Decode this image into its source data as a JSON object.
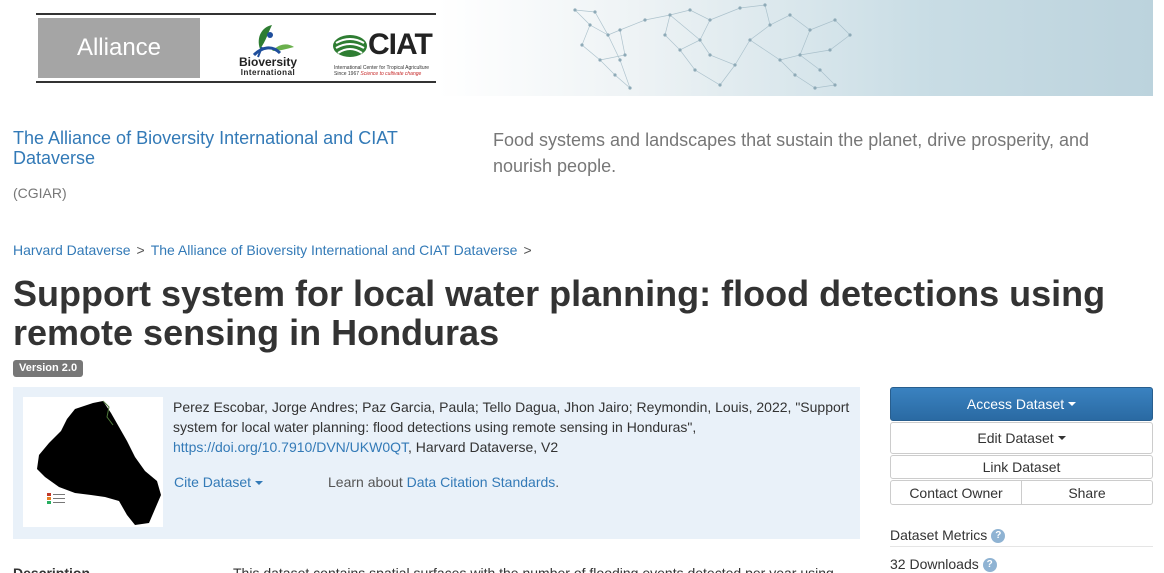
{
  "banner": {
    "alliance_label": "Alliance",
    "bioversity_name": "Bioversity",
    "bioversity_sub": "International",
    "ciat_name": "CIAT",
    "ciat_sub1": "International Center for Tropical Agriculture",
    "ciat_sub2_prefix": "Since 1967",
    "ciat_sub2_slogan": "Science to cultivate change",
    "colors": {
      "ciat_green": "#2e7d32",
      "bioversity_blue": "#1f4e9c",
      "slogan_red": "#c62828"
    }
  },
  "dataverse": {
    "title": "The Alliance of Bioversity International and CIAT Dataverse",
    "affiliation": "(CGIAR)",
    "tagline": "Food systems and landscapes that sustain the planet, drive prosperity, and nourish people."
  },
  "breadcrumb": {
    "items": [
      "Harvard Dataverse",
      "The Alliance of Bioversity International and CIAT Dataverse"
    ],
    "separator": ">"
  },
  "dataset": {
    "title": "Support system for local water planning: flood detections using remote sensing in Honduras",
    "version": "Version 2.0",
    "citation_prefix": "Perez Escobar, Jorge Andres; Paz Garcia, Paula; Tello Dagua, Jhon Jairo; Reymondin, Louis, 2022, \"Support system for local water planning: flood detections using remote sensing in Honduras\", ",
    "doi_link": "https://doi.org/10.7910/DVN/UKW0QT",
    "citation_suffix": ", Harvard Dataverse, V2",
    "cite_button": "Cite Dataset",
    "learn_prefix": "Learn about ",
    "learn_link": "Data Citation Standards",
    "learn_suffix": "."
  },
  "actions": {
    "access": "Access Dataset",
    "edit": "Edit Dataset",
    "link": "Link Dataset",
    "contact": "Contact Owner",
    "share": "Share"
  },
  "metrics": {
    "label": "Dataset Metrics",
    "downloads": "32 Downloads",
    "help_glyph": "?"
  },
  "description": {
    "label": "Description",
    "text": "This dataset contains spatial surfaces with the number of flooding events detected per year using"
  }
}
